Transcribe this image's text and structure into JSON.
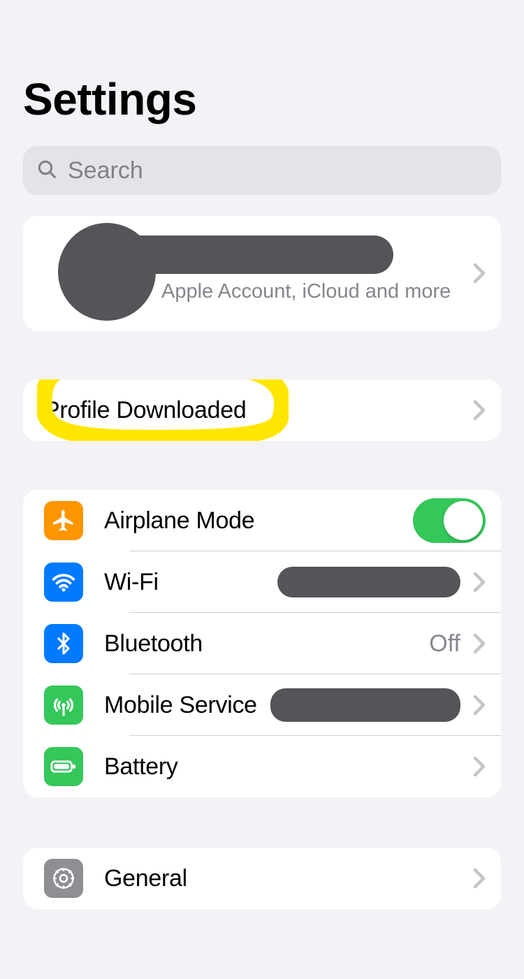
{
  "header": {
    "title": "Settings"
  },
  "search": {
    "placeholder": "Search",
    "value": ""
  },
  "account": {
    "subtext": "Apple Account, iCloud and more"
  },
  "profile": {
    "label": "Profile Downloaded"
  },
  "connectivity": {
    "items": [
      {
        "label": "Airplane Mode"
      },
      {
        "label": "Wi-Fi"
      },
      {
        "label": "Bluetooth",
        "value": "Off"
      },
      {
        "label": "Mobile Service"
      },
      {
        "label": "Battery"
      }
    ],
    "airplane_mode_on": true
  },
  "system": {
    "general_label": "General"
  },
  "colors": {
    "orange": "#ff9500",
    "blue": "#007aff",
    "green": "#34c759",
    "gray": "#8e8e93",
    "redaction": "#545459",
    "highlight": "#ffe600"
  },
  "annotation": {
    "highlighted_item": "Profile Downloaded"
  }
}
